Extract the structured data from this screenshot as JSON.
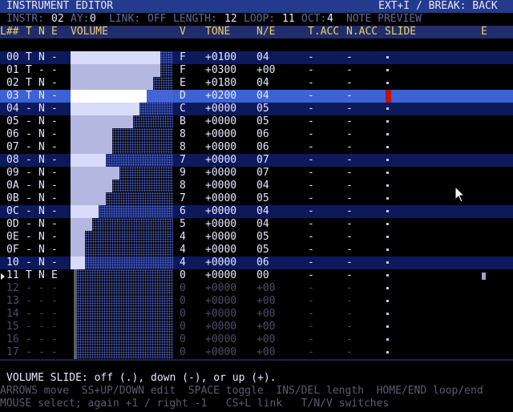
{
  "title": {
    "left": "INSTRUMENT EDITOR",
    "right": "EXT+I / BREAK: BACK"
  },
  "status": {
    "instr_label": "INSTR:",
    "instr_value": "02",
    "ay_label": "AY:",
    "ay_value": "0",
    "link_label": "LINK:",
    "link_value": "OFF",
    "length_label": "LENGTH:",
    "length_value": "12",
    "loop_label": "LOOP:",
    "loop_value": "11",
    "oct_label": "OCT:",
    "oct_value": "4",
    "preview": "NOTE PREVIEW"
  },
  "headers": {
    "line": "L##",
    "t": "T",
    "n": "N",
    "e": "E",
    "volume": "VOLUME",
    "v": "V",
    "tone": "TONE",
    "ne": "N/E",
    "tacc": "T.ACC",
    "nacc": "N.ACC",
    "slide": "SLIDE",
    "e2": "E"
  },
  "rows": [
    {
      "line": "00",
      "t": "T",
      "n": "N",
      "e": "-",
      "v": "F",
      "tone": "+0100",
      "ne": "04",
      "tacc": "-",
      "nacc": "-",
      "vol": 15
    },
    {
      "line": "01",
      "t": "T",
      "n": "-",
      "e": "-",
      "v": "F",
      "tone": "+0300",
      "ne": "+00",
      "tacc": "-",
      "nacc": "-",
      "vol": 15
    },
    {
      "line": "02",
      "t": "T",
      "n": "N",
      "e": "-",
      "v": "E",
      "tone": "+0180",
      "ne": "04",
      "tacc": "-",
      "nacc": "-",
      "vol": 14
    },
    {
      "line": "03",
      "t": "T",
      "n": "N",
      "e": "-",
      "v": "D",
      "tone": "+0200",
      "ne": "04",
      "tacc": "-",
      "nacc": "-",
      "vol": 13
    },
    {
      "line": "04",
      "t": "-",
      "n": "N",
      "e": "-",
      "v": "C",
      "tone": "+0000",
      "ne": "05",
      "tacc": "-",
      "nacc": "-",
      "vol": 12
    },
    {
      "line": "05",
      "t": "-",
      "n": "N",
      "e": "-",
      "v": "B",
      "tone": "+0000",
      "ne": "05",
      "tacc": "-",
      "nacc": "-",
      "vol": 11
    },
    {
      "line": "06",
      "t": "-",
      "n": "N",
      "e": "-",
      "v": "8",
      "tone": "+0000",
      "ne": "06",
      "tacc": "-",
      "nacc": "-",
      "vol": 8
    },
    {
      "line": "07",
      "t": "-",
      "n": "N",
      "e": "-",
      "v": "8",
      "tone": "+0000",
      "ne": "06",
      "tacc": "-",
      "nacc": "-",
      "vol": 8
    },
    {
      "line": "08",
      "t": "-",
      "n": "N",
      "e": "-",
      "v": "7",
      "tone": "+0000",
      "ne": "07",
      "tacc": "-",
      "nacc": "-",
      "vol": 7
    },
    {
      "line": "09",
      "t": "-",
      "n": "N",
      "e": "-",
      "v": "9",
      "tone": "+0000",
      "ne": "07",
      "tacc": "-",
      "nacc": "-",
      "vol": 9
    },
    {
      "line": "0A",
      "t": "-",
      "n": "N",
      "e": "-",
      "v": "8",
      "tone": "+0000",
      "ne": "04",
      "tacc": "-",
      "nacc": "-",
      "vol": 8
    },
    {
      "line": "0B",
      "t": "-",
      "n": "N",
      "e": "-",
      "v": "7",
      "tone": "+0000",
      "ne": "05",
      "tacc": "-",
      "nacc": "-",
      "vol": 7
    },
    {
      "line": "0C",
      "t": "-",
      "n": "N",
      "e": "-",
      "v": "6",
      "tone": "+0000",
      "ne": "04",
      "tacc": "-",
      "nacc": "-",
      "vol": 6
    },
    {
      "line": "0D",
      "t": "-",
      "n": "N",
      "e": "-",
      "v": "5",
      "tone": "+0000",
      "ne": "04",
      "tacc": "-",
      "nacc": "-",
      "vol": 5
    },
    {
      "line": "0E",
      "t": "-",
      "n": "N",
      "e": "-",
      "v": "4",
      "tone": "+0000",
      "ne": "05",
      "tacc": "-",
      "nacc": "-",
      "vol": 4
    },
    {
      "line": "0F",
      "t": "-",
      "n": "N",
      "e": "-",
      "v": "4",
      "tone": "+0000",
      "ne": "05",
      "tacc": "-",
      "nacc": "-",
      "vol": 4
    },
    {
      "line": "10",
      "t": "-",
      "n": "N",
      "e": "-",
      "v": "4",
      "tone": "+0000",
      "ne": "06",
      "tacc": "-",
      "nacc": "-",
      "vol": 4
    },
    {
      "line": "11",
      "t": "T",
      "n": "N",
      "e": "E",
      "v": "0",
      "tone": "+0000",
      "ne": "00",
      "tacc": "-",
      "nacc": "-",
      "vol": 0
    },
    {
      "line": "12",
      "t": "-",
      "n": "-",
      "e": "-",
      "v": "0",
      "tone": "+0000",
      "ne": "+00",
      "tacc": "-",
      "nacc": "-",
      "vol": 0
    },
    {
      "line": "13",
      "t": "-",
      "n": "-",
      "e": "-",
      "v": "0",
      "tone": "+0000",
      "ne": "+00",
      "tacc": "-",
      "nacc": "-",
      "vol": 0
    },
    {
      "line": "14",
      "t": "-",
      "n": "-",
      "e": "-",
      "v": "0",
      "tone": "+0000",
      "ne": "+00",
      "tacc": "-",
      "nacc": "-",
      "vol": 0
    },
    {
      "line": "15",
      "t": "-",
      "n": "-",
      "e": "-",
      "v": "0",
      "tone": "+0000",
      "ne": "+00",
      "tacc": "-",
      "nacc": "-",
      "vol": 0
    },
    {
      "line": "16",
      "t": "-",
      "n": "-",
      "e": "-",
      "v": "0",
      "tone": "+0000",
      "ne": "+00",
      "tacc": "-",
      "nacc": "-",
      "vol": 0
    },
    {
      "line": "17",
      "t": "-",
      "n": "-",
      "e": "-",
      "v": "0",
      "tone": "+0000",
      "ne": "+00",
      "tacc": "-",
      "nacc": "-",
      "vol": 0
    }
  ],
  "help": {
    "hint": "VOLUME SLIDE: off (.), down (-), or up (+).",
    "keys1": "ARROWS move  SS+UP/DOWN edit  SPACE toggle  INS/DEL length  HOME/END loop/end",
    "keys2": "MOUSE select; again +1 / right -1   CS+L link   T/N/V switches"
  },
  "colors": {
    "accent": "#3c62d6",
    "title_bg": "#243a8c",
    "header_text": "#f0d060"
  },
  "icons": {
    "pointer": "mouse-pointer-icon",
    "play": "play-marker-icon"
  }
}
